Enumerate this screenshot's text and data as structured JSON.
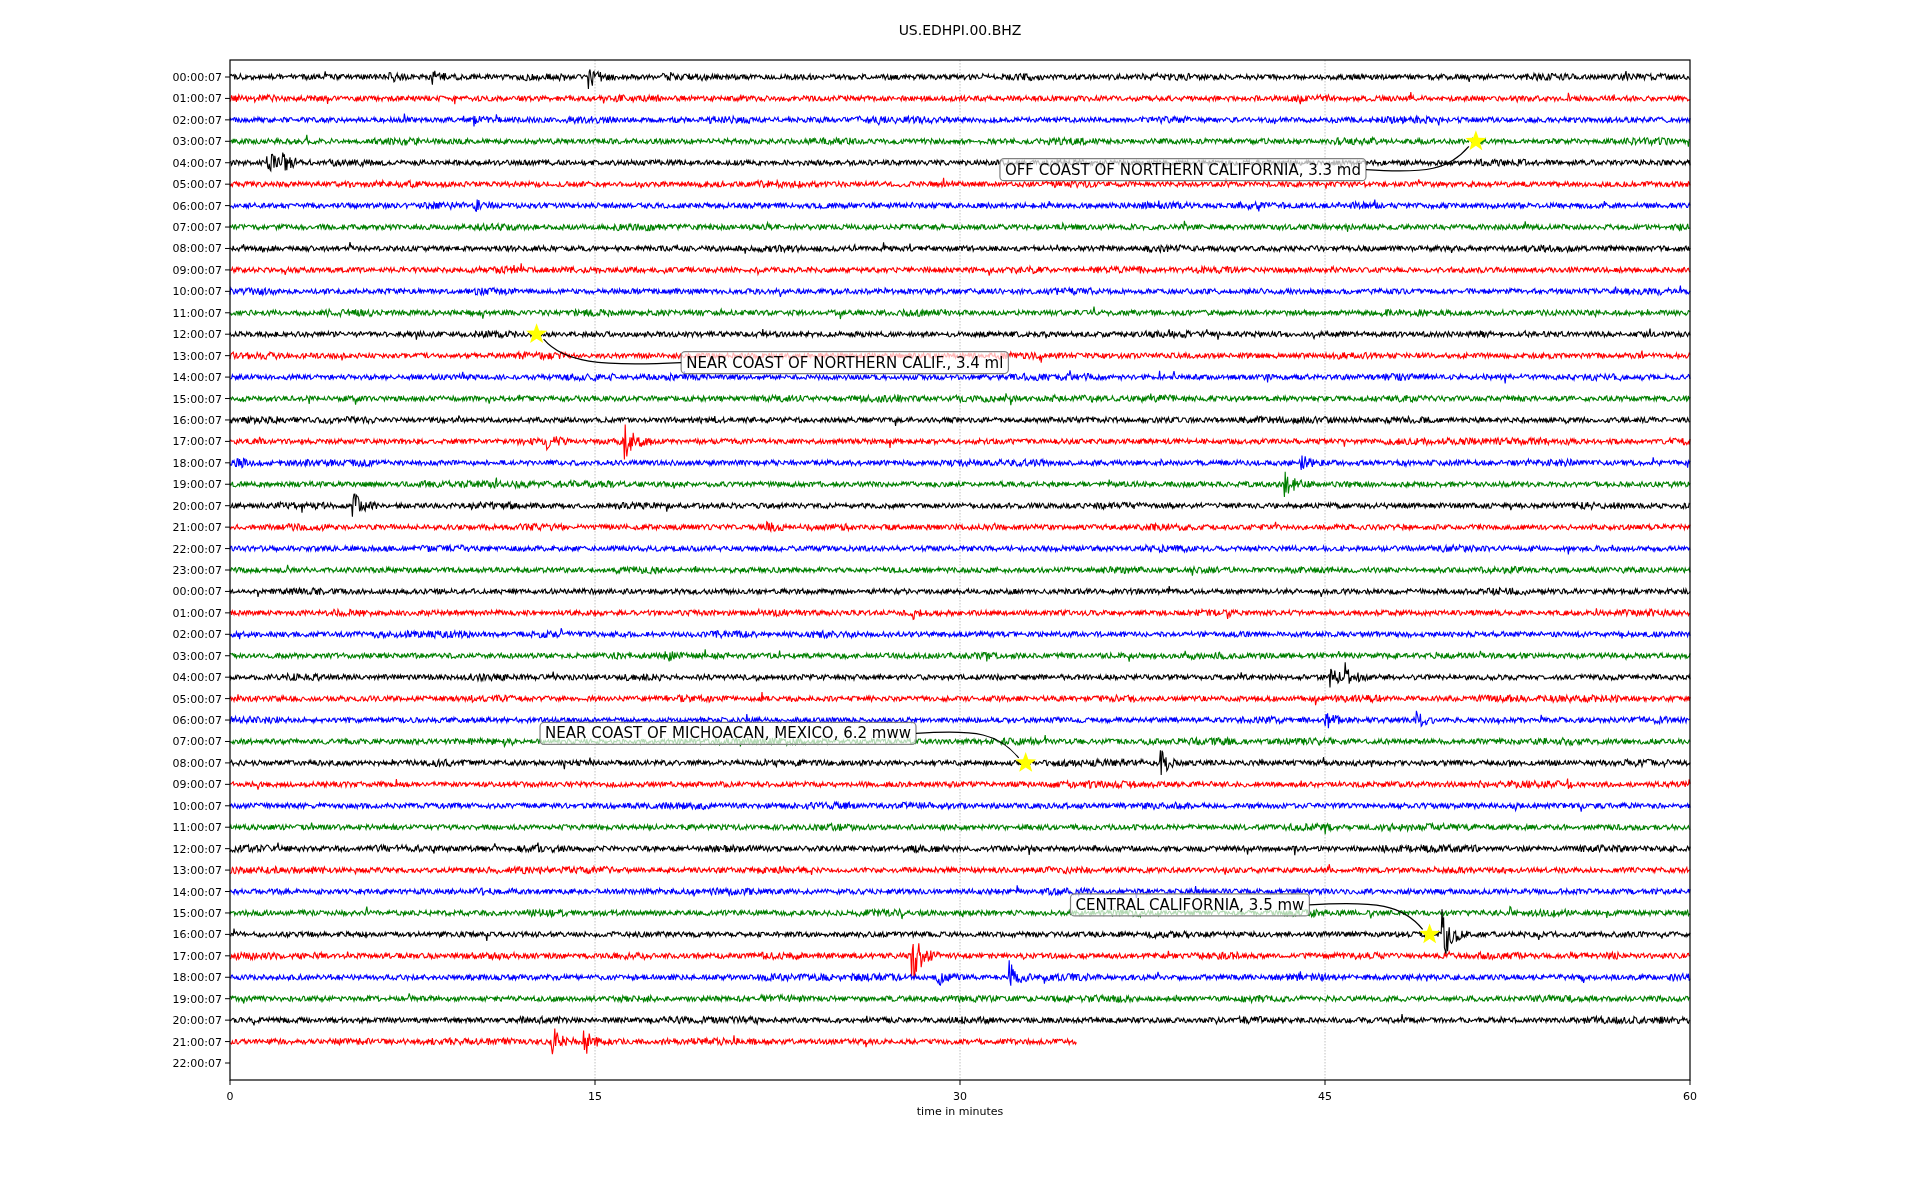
{
  "figure": {
    "title": "US.EDHPI.00.BHZ",
    "x_axis": {
      "label": "time in minutes",
      "ticks": [
        "0",
        "15",
        "30",
        "45",
        "60"
      ]
    },
    "rows": [
      {
        "label": "00:00:07",
        "color": "#000000",
        "level": 1
      },
      {
        "label": "01:00:07",
        "color": "#ff0000",
        "level": 1
      },
      {
        "label": "02:00:07",
        "color": "#0000ff",
        "level": 1
      },
      {
        "label": "03:00:07",
        "color": "#008000",
        "level": 1
      },
      {
        "label": "04:00:07",
        "color": "#000000",
        "level": 1
      },
      {
        "label": "05:00:07",
        "color": "#ff0000",
        "level": 1
      },
      {
        "label": "06:00:07",
        "color": "#0000ff",
        "level": 1
      },
      {
        "label": "07:00:07",
        "color": "#008000",
        "level": 1
      },
      {
        "label": "08:00:07",
        "color": "#000000",
        "level": 1
      },
      {
        "label": "09:00:07",
        "color": "#ff0000",
        "level": 1
      },
      {
        "label": "10:00:07",
        "color": "#0000ff",
        "level": 1
      },
      {
        "label": "11:00:07",
        "color": "#008000",
        "level": 1
      },
      {
        "label": "12:00:07",
        "color": "#000000",
        "level": 1
      },
      {
        "label": "13:00:07",
        "color": "#ff0000",
        "level": 1
      },
      {
        "label": "14:00:07",
        "color": "#0000ff",
        "level": 1
      },
      {
        "label": "15:00:07",
        "color": "#008000",
        "level": 1
      },
      {
        "label": "16:00:07",
        "color": "#000000",
        "level": 1
      },
      {
        "label": "17:00:07",
        "color": "#ff0000",
        "level": 1
      },
      {
        "label": "18:00:07",
        "color": "#0000ff",
        "level": 1
      },
      {
        "label": "19:00:07",
        "color": "#008000",
        "level": 1
      },
      {
        "label": "20:00:07",
        "color": "#000000",
        "level": 1
      },
      {
        "label": "21:00:07",
        "color": "#ff0000",
        "level": 1
      },
      {
        "label": "22:00:07",
        "color": "#0000ff",
        "level": 1
      },
      {
        "label": "23:00:07",
        "color": "#008000",
        "level": 1
      },
      {
        "label": "00:00:07",
        "color": "#000000",
        "level": 1
      },
      {
        "label": "01:00:07",
        "color": "#ff0000",
        "level": 1
      },
      {
        "label": "02:00:07",
        "color": "#0000ff",
        "level": 1
      },
      {
        "label": "03:00:07",
        "color": "#008000",
        "level": 1
      },
      {
        "label": "04:00:07",
        "color": "#000000",
        "level": 1
      },
      {
        "label": "05:00:07",
        "color": "#ff0000",
        "level": 1
      },
      {
        "label": "06:00:07",
        "color": "#0000ff",
        "level": 1
      },
      {
        "label": "07:00:07",
        "color": "#008000",
        "level": 1
      },
      {
        "label": "08:00:07",
        "color": "#000000",
        "level": 1
      },
      {
        "label": "09:00:07",
        "color": "#ff0000",
        "level": 1
      },
      {
        "label": "10:00:07",
        "color": "#0000ff",
        "level": 1
      },
      {
        "label": "11:00:07",
        "color": "#008000",
        "level": 1
      },
      {
        "label": "12:00:07",
        "color": "#000000",
        "level": 1
      },
      {
        "label": "13:00:07",
        "color": "#ff0000",
        "level": 1
      },
      {
        "label": "14:00:07",
        "color": "#0000ff",
        "level": 1
      },
      {
        "label": "15:00:07",
        "color": "#008000",
        "level": 1
      },
      {
        "label": "16:00:07",
        "color": "#000000",
        "level": 1
      },
      {
        "label": "17:00:07",
        "color": "#ff0000",
        "level": 1
      },
      {
        "label": "18:00:07",
        "color": "#0000ff",
        "level": 1
      },
      {
        "label": "19:00:07",
        "color": "#008000",
        "level": 1
      },
      {
        "label": "20:00:07",
        "color": "#000000",
        "level": 1
      },
      {
        "label": "21:00:07",
        "color": "#ff0000",
        "level": 0.58
      },
      {
        "label": "22:00:07"
      }
    ],
    "events": [
      {
        "text": "OFF COAST OF NORTHERN CALIFORNIA, 3.3 md"
      },
      {
        "text": "NEAR COAST OF NORTHERN CALIF., 3.4 ml"
      },
      {
        "text": "NEAR COAST OF MICHOACAN, MEXICO, 6.2 mww"
      },
      {
        "text": "CENTRAL CALIFORNIA, 3.5 mw"
      }
    ]
  }
}
